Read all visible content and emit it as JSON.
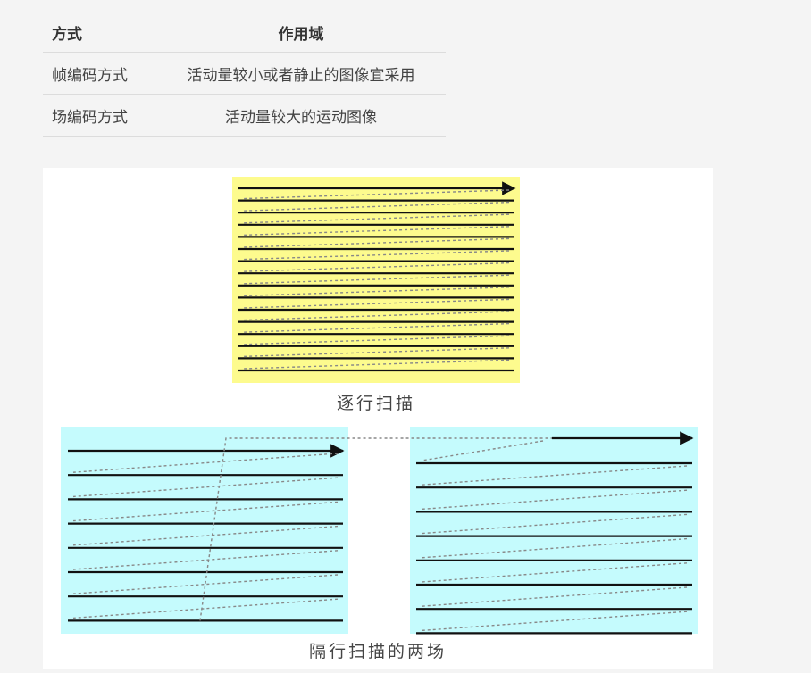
{
  "table": {
    "headers": [
      "方式",
      "作用域"
    ],
    "rows": [
      [
        "帧编码方式",
        "活动量较小或者静止的图像宜采用"
      ],
      [
        "场编码方式",
        "活动量较大的运动图像"
      ]
    ]
  },
  "figure": {
    "progressive_caption": "逐行扫描",
    "interlaced_caption": "隔行扫描的两场",
    "colors": {
      "progressive_bg": "#fdfb8e",
      "interlaced_bg": "#c5fbfd",
      "scan_line": "#111111",
      "retrace": "#888888"
    },
    "progressive_lines": 16,
    "interlaced_lines_per_field": 8
  }
}
